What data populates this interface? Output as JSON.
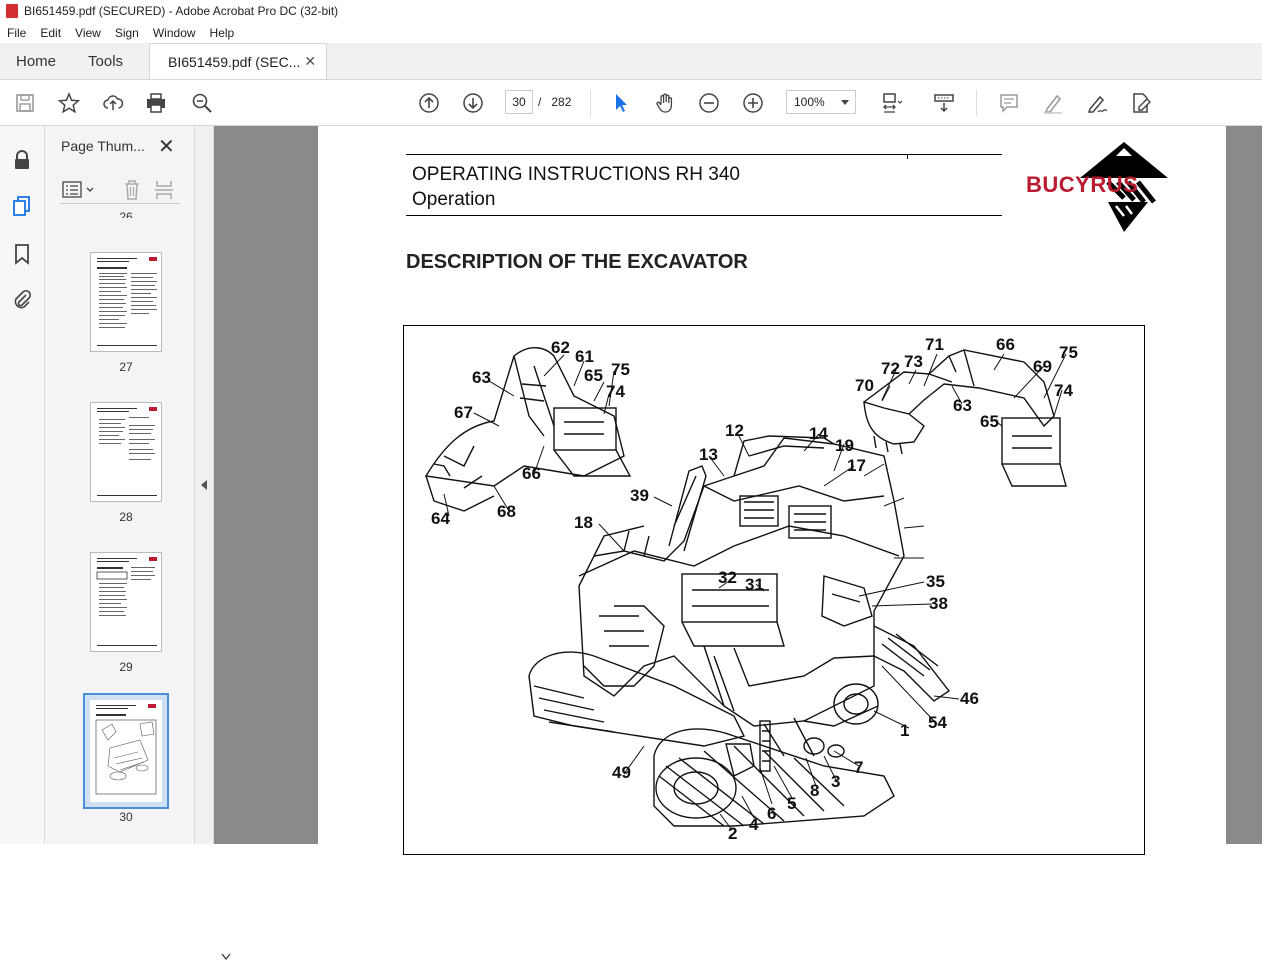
{
  "window": {
    "title": "BI651459.pdf (SECURED) - Adobe Acrobat Pro DC (32-bit)"
  },
  "menu": [
    "File",
    "Edit",
    "View",
    "Sign",
    "Window",
    "Help"
  ],
  "tabs": {
    "home": "Home",
    "tools": "Tools",
    "doc": "BI651459.pdf (SEC..."
  },
  "nav": {
    "page": "30",
    "page_sep": "/",
    "total": "282",
    "zoom": "100%"
  },
  "thumbnails": {
    "title": "Page Thum...",
    "partial_label": "26",
    "pages": [
      {
        "label": "27"
      },
      {
        "label": "28"
      },
      {
        "label": "29"
      },
      {
        "label": "30",
        "selected": true
      }
    ]
  },
  "document": {
    "title_line1": "OPERATING INSTRUCTIONS RH 340",
    "title_line2": "Operation",
    "logo": "BUCYRUS",
    "heading": "DESCRIPTION OF THE EXCAVATOR",
    "callouts": [
      "62",
      "61",
      "75",
      "63",
      "65",
      "74",
      "67",
      "66",
      "68",
      "64",
      "12",
      "14",
      "13",
      "19",
      "17",
      "39",
      "18",
      "32",
      "31",
      "35",
      "38",
      "46",
      "54",
      "1",
      "7",
      "3",
      "8",
      "5",
      "6",
      "4",
      "2",
      "49",
      "71",
      "66",
      "72",
      "73",
      "70",
      "69",
      "75",
      "74",
      "63",
      "65",
      "14",
      "12",
      "19",
      "13"
    ]
  },
  "colors": {
    "brand": "#b81c2e",
    "accent_blue": "#1a73e8",
    "selected_thumb": "#4a90d9"
  }
}
